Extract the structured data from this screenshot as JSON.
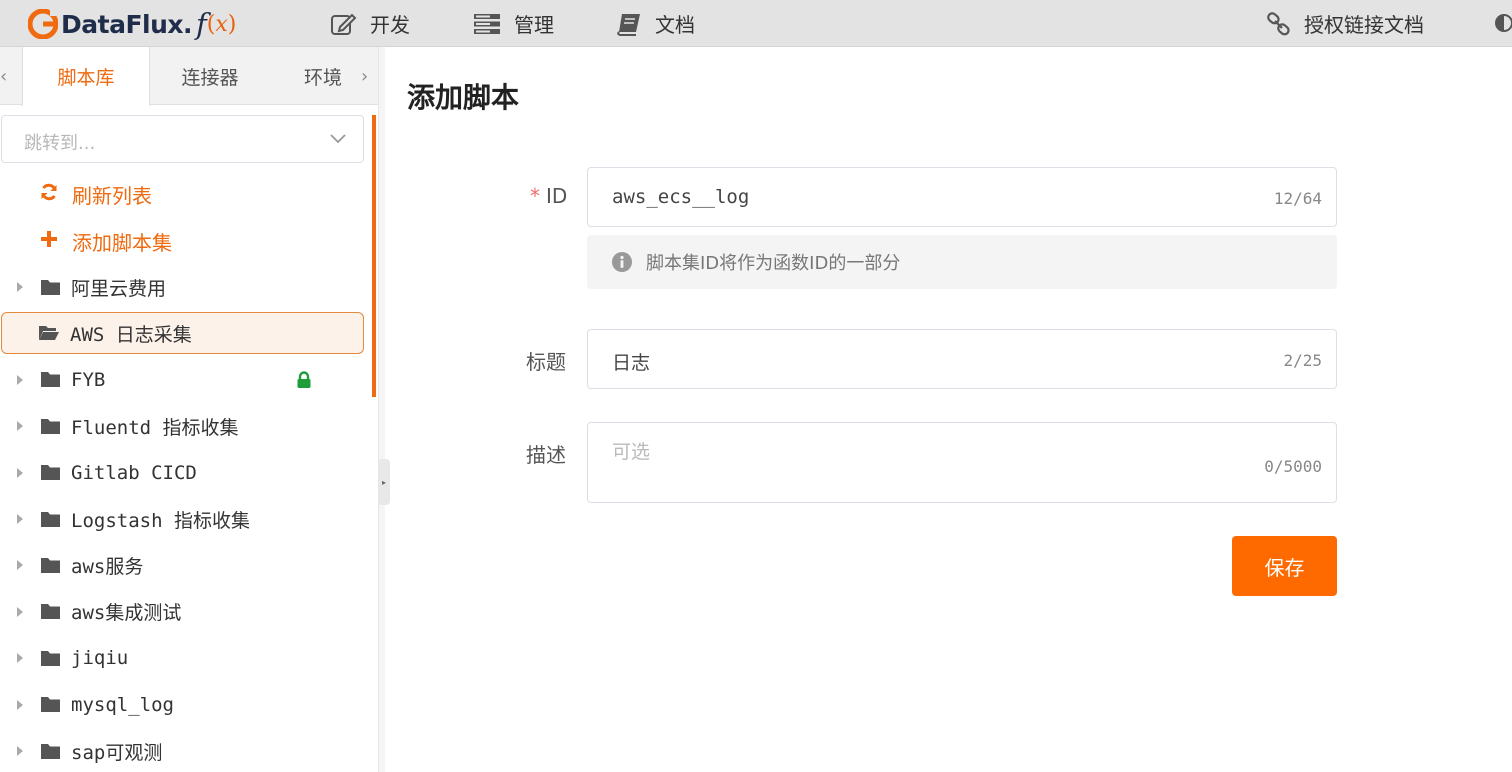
{
  "app": {
    "brand": "DataFlux.",
    "fx_f": "f",
    "fx_open": "(",
    "fx_x": "x",
    "fx_close": ")"
  },
  "nav": {
    "dev": "开发",
    "manage": "管理",
    "docs": "文档",
    "auth_link_docs": "授权链接文档"
  },
  "sidebar": {
    "tabs": [
      "脚本库",
      "连接器",
      "环境"
    ],
    "jump_placeholder": "跳转到...",
    "actions": {
      "refresh": "刷新列表",
      "add_set": "添加脚本集"
    },
    "items": [
      {
        "label": "阿里云费用"
      },
      {
        "label": "AWS 日志采集",
        "selected": true
      },
      {
        "label": "FYB",
        "locked": true
      },
      {
        "label": "Fluentd 指标收集"
      },
      {
        "label": "Gitlab CICD"
      },
      {
        "label": "Logstash 指标收集"
      },
      {
        "label": "aws服务"
      },
      {
        "label": "aws集成测试"
      },
      {
        "label": "jiqiu"
      },
      {
        "label": "mysql_log"
      },
      {
        "label": "sap可观测"
      }
    ]
  },
  "main": {
    "title": "添加脚本",
    "form": {
      "id": {
        "label": "ID",
        "required_mark": "*",
        "value": "aws_ecs__log",
        "count": "12/64",
        "hint": "脚本集ID将作为函数ID的一部分"
      },
      "title": {
        "label": "标题",
        "value": "日志",
        "count": "2/25"
      },
      "desc": {
        "label": "描述",
        "placeholder": "可选",
        "count": "0/5000"
      }
    },
    "save_label": "保存"
  },
  "colors": {
    "accent": "#ff6a00",
    "lock": "#1e9e3a",
    "required": "#f56c6c"
  }
}
